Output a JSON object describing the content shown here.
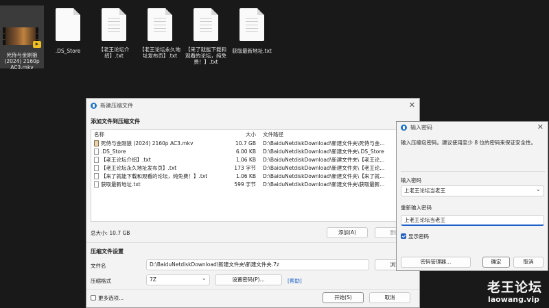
{
  "files": [
    {
      "name": "死侍与金刚狼 (2024) 2160p AC3.mkv",
      "type": "video",
      "selected": true
    },
    {
      "name": ".DS_Store",
      "type": "document"
    },
    {
      "name": "【老王论坛介绍】.txt",
      "type": "document"
    },
    {
      "name": "【老王论坛永久地址发布页】.txt",
      "type": "document"
    },
    {
      "name": "【来了就能下载和观看的论坛，纯免费！】.txt",
      "type": "document"
    },
    {
      "name": "获取最新地址.txt",
      "type": "document"
    }
  ],
  "main_dialog": {
    "title": "新建压缩文件",
    "add_section": "添加文件到压缩文件",
    "columns": {
      "name": "名称",
      "size": "大小",
      "path": "文件路径"
    },
    "rows": [
      {
        "name": "死侍与金刚狼 (2024) 2160p AC3.mkv",
        "size": "10.7 GB",
        "path": "D:\\BaiduNetdiskDownload\\新建文件夹\\死侍与金...",
        "icon": "video-file-icon"
      },
      {
        "name": ".DS_Store",
        "size": "6.00 KB",
        "path": "D:\\BaiduNetdiskDownload\\新建文件夹\\.DS_Store",
        "icon": "file-icon"
      },
      {
        "name": "【老王论坛介绍】.txt",
        "size": "1.06 KB",
        "path": "D:\\BaiduNetdiskDownload\\新建文件夹\\【老王论...",
        "icon": "text-file-icon"
      },
      {
        "name": "【老王论坛永久地址发布页】.txt",
        "size": "173 字节",
        "path": "D:\\BaiduNetdiskDownload\\新建文件夹\\【老王论...",
        "icon": "text-file-icon"
      },
      {
        "name": "【来了就能下载和观看的论坛，纯免费！】.txt",
        "size": "1.06 KB",
        "path": "D:\\BaiduNetdiskDownload\\新建文件夹\\【来了就...",
        "icon": "text-file-icon"
      },
      {
        "name": "获取最新地址.txt",
        "size": "599 字节",
        "path": "D:\\BaiduNetdiskDownload\\新建文件夹\\获取最新...",
        "icon": "text-file-icon"
      }
    ],
    "total_size": "总大小: 10.7 GB",
    "add_button": "添加(A)",
    "delete_button": "删除",
    "settings_section": "压缩文件设置",
    "filename_label": "文件名",
    "filename_value": "D:\\BaiduNetdiskDownload\\新建文件夹\\新建文件夹.7z",
    "browse_button": "浏览",
    "format_label": "压缩格式",
    "format_value": "7Z",
    "set_password_button": "设置密码(P)...",
    "help_link": "[帮助]",
    "more_options": "更多选项...",
    "start_button": "开始(S)",
    "cancel_button": "取消"
  },
  "password_dialog": {
    "title": "输入密码",
    "description": "输入压缩包密码。建议使用至少 8 位的密码来保证安全性。",
    "password_label": "输入密码",
    "password_value": "上老王论坛当老王",
    "confirm_label": "重新输入密码",
    "confirm_value": "上老王论坛当老王",
    "show_password": "显示密码",
    "show_password_checked": true,
    "manager_button": "密码管理器...",
    "ok_button": "确定",
    "cancel_button": "取消"
  },
  "watermark": {
    "title": "老王论坛",
    "url": "laowang.vip"
  }
}
